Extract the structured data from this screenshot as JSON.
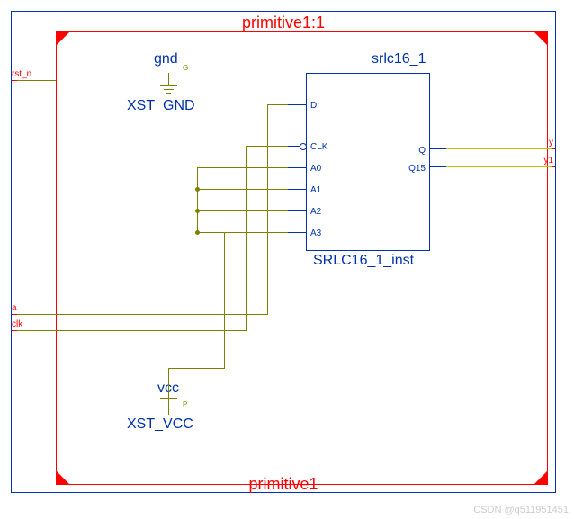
{
  "frame": {
    "title_top": "primitive1:1",
    "title_bottom": "primitive1"
  },
  "components": {
    "gnd": {
      "label": "gnd",
      "pin": "G",
      "name": "XST_GND"
    },
    "vcc": {
      "label": "vcc",
      "pin": "P",
      "name": "XST_VCC"
    },
    "srlc": {
      "label": "srlc16_1",
      "name": "SRLC16_1_inst",
      "ports_left": [
        "D",
        "CLK",
        "A0",
        "A1",
        "A2",
        "A3"
      ],
      "ports_right": [
        "Q",
        "Q15"
      ]
    }
  },
  "ports": {
    "rst_n": "rst_n",
    "a": "a",
    "clk": "clk",
    "y": "y",
    "y1": "y1"
  },
  "watermark": "CSDN @q511951451"
}
